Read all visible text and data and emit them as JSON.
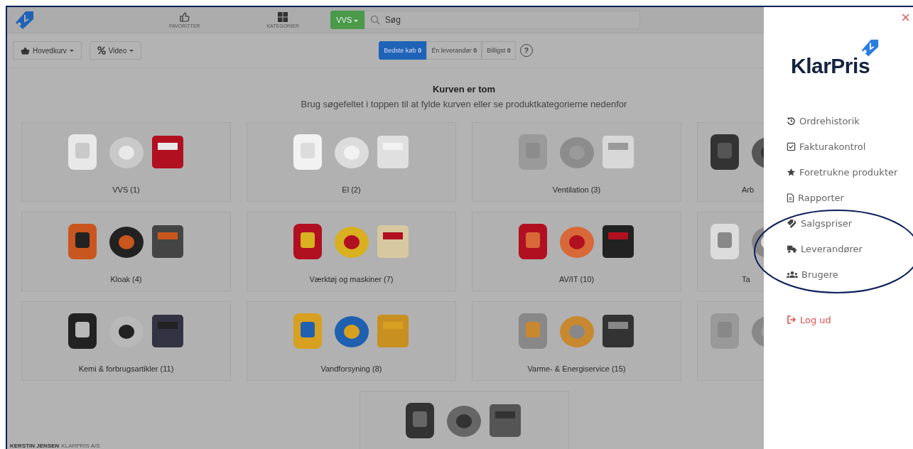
{
  "header": {
    "nav": [
      {
        "label": "FAVORITTER"
      },
      {
        "label": "KATEGORIER"
      }
    ],
    "category_dropdown": {
      "label": "VVS"
    },
    "search": {
      "placeholder": "Søg"
    }
  },
  "toolbar": {
    "dropdowns": [
      {
        "label": "Hovedkurv"
      },
      {
        "label": "Video"
      }
    ],
    "filters": [
      {
        "label": "Bedste køb **0**",
        "selected": true
      },
      {
        "label": "Én leverandør **0**",
        "selected": false
      },
      {
        "label": "Billigst **0**",
        "selected": false
      }
    ],
    "help": "?"
  },
  "empty_state": {
    "title": "Kurven er tom",
    "subtitle": "Brug søgefeltet i toppen til at fylde kurven eller se produktkategorierne nedenfor"
  },
  "categories": [
    {
      "kind": "category",
      "label": "VVS (1)"
    },
    {
      "kind": "category",
      "label": "El (2)"
    },
    {
      "kind": "category",
      "label": "Ventilation (3)"
    },
    {
      "kind": "category",
      "label": "Arb"
    },
    {
      "kind": "category",
      "label": "Kloak (4)"
    },
    {
      "kind": "category",
      "label": "Værktøj og maskiner (7)"
    },
    {
      "kind": "category",
      "label": "AV/IT (10)"
    },
    {
      "kind": "category",
      "label": "Ta"
    },
    {
      "kind": "category",
      "label": "Kemi & forbrugsartikler (11)"
    },
    {
      "kind": "category",
      "label": "Vandforsyning (8)"
    },
    {
      "kind": "category",
      "label": "Varme- & Energiservice (15)"
    },
    {
      "kind": "unlabeled"
    },
    {
      "kind": "unlabeled"
    }
  ],
  "footer": {
    "user": "KERSTIN JENSEN",
    "company": "KLARPRIS A/S"
  },
  "side_panel": {
    "close": "×",
    "logo": "KlarPris",
    "menu": [
      {
        "kind": "link",
        "label": "Ordrehistorik"
      },
      {
        "kind": "link",
        "label": "Fakturakontrol"
      },
      {
        "kind": "link",
        "label": "Foretrukne produkter"
      },
      {
        "kind": "link",
        "label": "Rapporter"
      },
      {
        "kind": "link",
        "label": "Salgspriser"
      },
      {
        "kind": "link",
        "label": "Leverandører"
      },
      {
        "kind": "link",
        "label": "Brugere"
      },
      {
        "kind": "logout",
        "label": "Log ud"
      }
    ]
  }
}
